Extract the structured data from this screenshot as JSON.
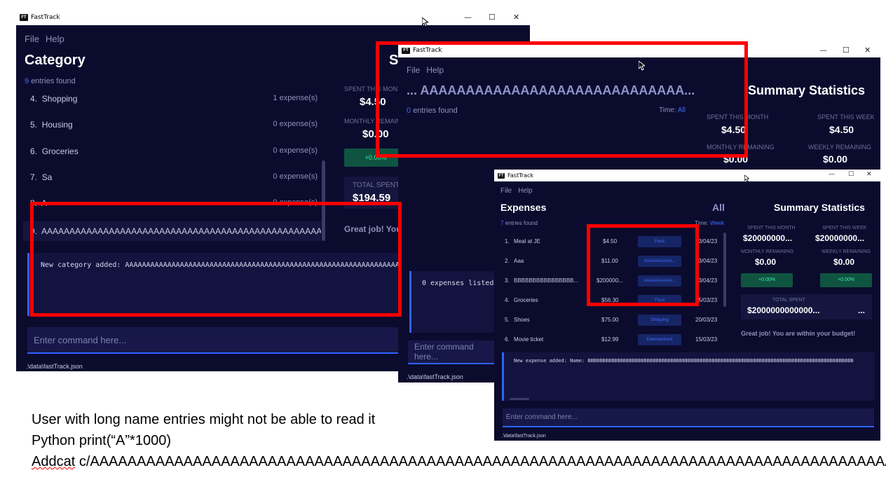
{
  "app_title": "FastTrack",
  "logo_text": "FT",
  "window_controls": {
    "minimize": "—",
    "maximize": "☐",
    "close": "✕"
  },
  "menu": {
    "file": "File",
    "help": "Help"
  },
  "win1": {
    "heading": "Category",
    "heading_right": "S",
    "entries_count": "9",
    "entries_label": "entries found",
    "rows": [
      {
        "index": "4.",
        "name": "Shopping",
        "count": "1 expense(s)"
      },
      {
        "index": "5.",
        "name": "Housing",
        "count": "0 expense(s)"
      },
      {
        "index": "6.",
        "name": "Groceries",
        "count": "0 expense(s)"
      },
      {
        "index": "7.",
        "name": "Sa",
        "count": "0 expense(s)"
      },
      {
        "index": "8.",
        "name": "A",
        "count": "0 expense(s)"
      }
    ],
    "selected_row": {
      "index": "9.",
      "name": "AAAAAAAAAAAAAAAAAAAAAAAAAAAAAAAAAAAAAAAAAAAAAAAAAAAAAAAAAAAAA"
    },
    "spent_month_label": "SPENT THIS MONTH",
    "spent_month_value": "$4.50",
    "monthly_remaining_label": "MONTHLY REMAINING",
    "monthly_remaining_value": "$0.00",
    "pct": "+0.00%",
    "total_spent_label": "TOTAL SPENT",
    "total_spent_value": "$194.59",
    "great_job": "Great job! You",
    "result": "New category added: AAAAAAAAAAAAAAAAAAAAAAAAAAAAAAAAAAAAAAAAAAAAAAAAAAAAAAAAAAAAAAAAAAAAAAA",
    "command_placeholder": "Enter command here...",
    "status": ".\\data\\fastTrack.json"
  },
  "win2": {
    "heading": "... AAAAAAAAAAAAAAAAAAAAAAAAAAAAA...",
    "summary_title": "Summary Statistics",
    "entries_count": "0",
    "entries_label": "entries found",
    "time_label": "Time:",
    "time_value": "All",
    "spent_month_label": "SPENT THIS MONTH",
    "spent_month_value": "$4.50",
    "spent_week_label": "SPENT THIS WEEK",
    "spent_week_value": "$4.50",
    "monthly_remaining_label": "MONTHLY REMAINING",
    "monthly_remaining_value": "$0.00",
    "weekly_remaining_label": "WEEKLY REMAINING",
    "weekly_remaining_value": "$0.00",
    "result": "0 expenses listed",
    "command_placeholder": "Enter command here...",
    "status": ".\\data\\fastTrack.json"
  },
  "win3": {
    "heading": "Expenses",
    "heading_right": "All",
    "summary_title": "Summary Statistics",
    "entries_count": "7",
    "entries_label": "entries found",
    "time_label": "Time:",
    "time_value": "Week",
    "rows": [
      {
        "index": "1.",
        "name": "Meal at JE",
        "amount": "$4.50",
        "category": "Food",
        "date": "03/04/23"
      },
      {
        "index": "2.",
        "name": "Aaa",
        "amount": "$11.00",
        "category": "AAAAAAAAAA...",
        "date": "03/04/23"
      },
      {
        "index": "3.",
        "name": "BBBBBBBBBBBBBBBB...",
        "amount": "$200000...",
        "category": "AAAAAAAAAA...",
        "date": "03/04/23"
      },
      {
        "index": "4.",
        "name": "Groceries",
        "amount": "$56.30",
        "category": "Food",
        "date": "25/03/23"
      },
      {
        "index": "5.",
        "name": "Shoes",
        "amount": "$75.00",
        "category": "Shopping",
        "date": "20/03/23"
      },
      {
        "index": "6.",
        "name": "Movie ticket",
        "amount": "$12.99",
        "category": "Entertainment",
        "date": "15/03/23"
      }
    ],
    "spent_month_label": "SPENT THIS MONTH",
    "spent_month_value": "$20000000...",
    "spent_week_label": "SPENT THIS WEEK",
    "spent_week_value": "$20000000...",
    "monthly_remaining_label": "MONTHLY REMAINING",
    "monthly_remaining_value": "$0.00",
    "weekly_remaining_label": "WEEKLY REMAINING",
    "weekly_remaining_value": "$0.00",
    "pct_month": "+0.00%",
    "pct_week": "+0.00%",
    "total_spent_label": "TOTAL SPENT",
    "total_spent_value": "$2000000000000...",
    "total_spent_ellipsis": "...",
    "great_job": "Great job! You are within your budget!",
    "result": "New expense added: Name: BBBBBBBBBBBBBBBBBBBBBBBBBBBBBBBBBBBBBBBBBBBBBBBBBBBBBBBBBBBBBBBBBBBBBBBBBBBBBBBBBBBBBBBBBB",
    "command_placeholder": "Enter command here...",
    "status": ".\\data\\fastTrack.json"
  },
  "captions": {
    "line1": "User with long name entries might not be able to read it",
    "line2": "Python print(“A”*1000)",
    "line3_word": "Addcat",
    "line3_rest": " c/AAAAAAAAAAAAAAAAAAAAAAAAAAAAAAAAAAAAAAAAAAAAAAAAAAAAAAAAAAAAAAAAAAAAAAAAAAAAAAAAAAAAAAAAAAAAAA"
  },
  "colors": {
    "background": "#0b0b2e",
    "accent": "#2e62ff",
    "highlight": "#ff0000",
    "positive": "#3ef0a5"
  }
}
